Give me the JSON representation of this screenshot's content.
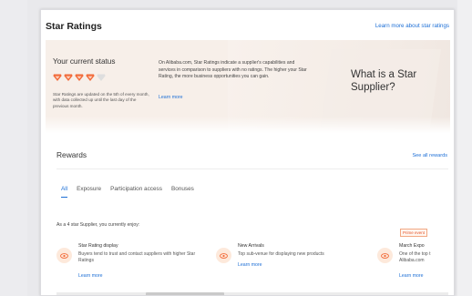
{
  "header": {
    "title": "Star Ratings",
    "learn_link": "Learn more about star ratings"
  },
  "status": {
    "title": "Your current status",
    "stars_filled": 4,
    "stars_total": 5,
    "star_color": "#f26b3a",
    "star_empty_color": "#dedede",
    "note": "Star Ratings are updated on the 5th of every month, with data collected up until the last day of the previous month."
  },
  "description": {
    "text": "On Alibaba.com, Star Ratings indicate a supplier's capabilities and services in comparison to suppliers with no ratings. The higher your Star Rating, the more business opportunities you can gain.",
    "link": "Learn more"
  },
  "what_is": "What is a Star Supplier?",
  "rewards": {
    "title": "Rewards",
    "see_all": "See all rewards",
    "tabs": [
      "All",
      "Exposure",
      "Participation access",
      "Bonuses"
    ],
    "active_tab": "All",
    "enjoy_text": "As a 4 star Supplier, you currently enjoy:",
    "benefits": [
      {
        "title": "Star Rating display",
        "desc": "Buyers tend to trust and contact suppliers with higher Star Ratings",
        "link": "Learn more",
        "icon": "eye-icon"
      },
      {
        "title": "New Arrivals",
        "desc": "Top sub-venue for displaying new products",
        "link": "Learn more",
        "icon": "eye-icon"
      },
      {
        "title": "March Expo",
        "desc": "One of the top t Alibaba.com",
        "link": "Learn more",
        "icon": "eye-icon",
        "badge": "Prime event"
      }
    ]
  },
  "colors": {
    "accent": "#1d6fd6",
    "orange": "#f26b3a",
    "banner_bg": "#f7efe9"
  }
}
